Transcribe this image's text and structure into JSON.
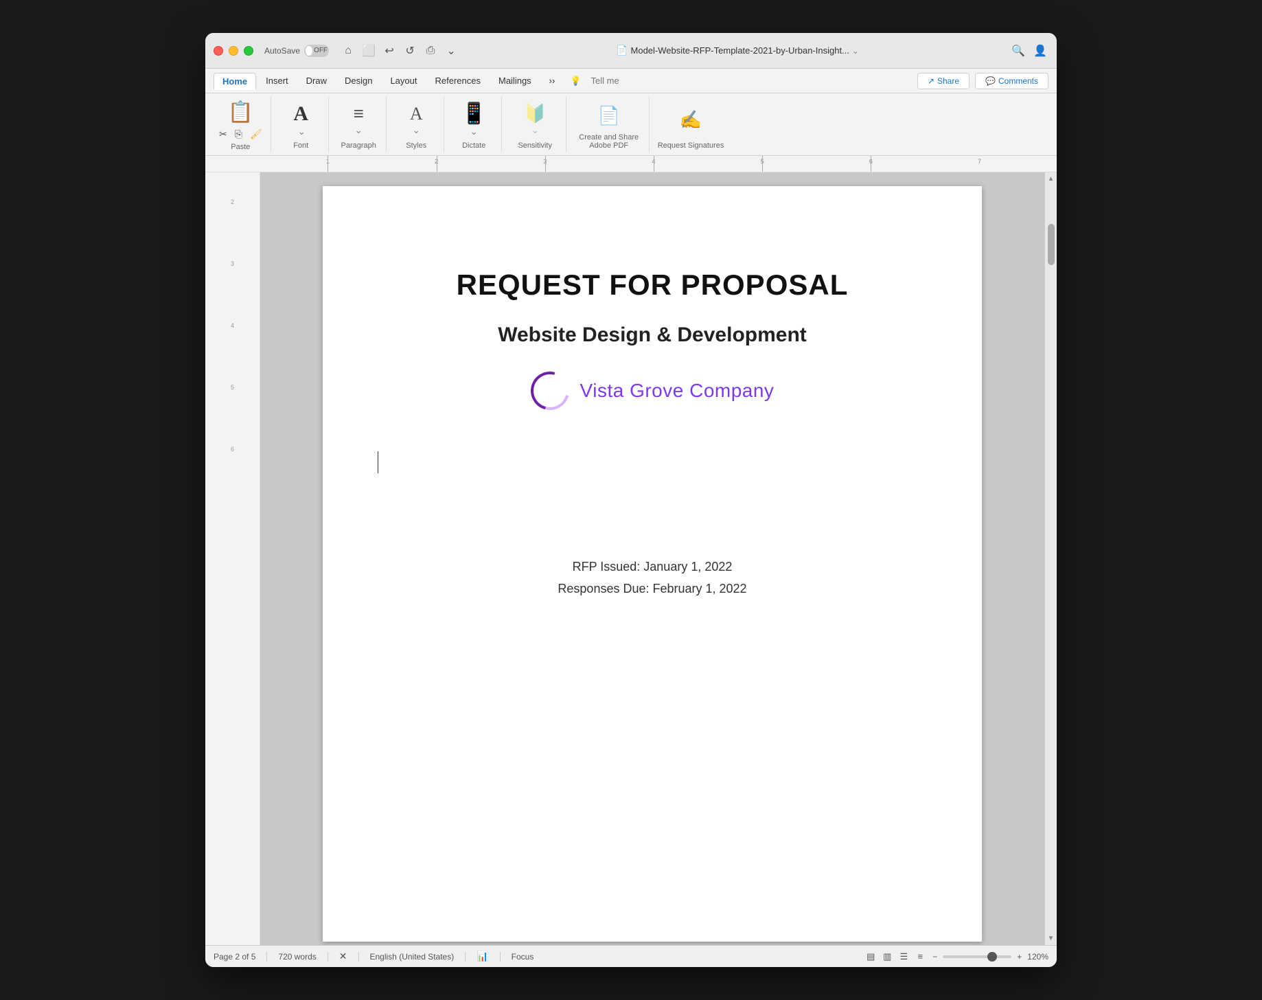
{
  "window": {
    "title": "Model-Website-RFP-Template-2021-by-Urban-Insight...",
    "autosave_label": "AutoSave",
    "autosave_state": "OFF"
  },
  "ribbon": {
    "tabs": [
      "Home",
      "Insert",
      "Draw",
      "Design",
      "Layout",
      "References",
      "Mailings"
    ],
    "active_tab": "Home",
    "more_label": "···",
    "tell_me_placeholder": "Tell me",
    "share_label": "Share",
    "comments_label": "Comments"
  },
  "toolbar": {
    "paste_label": "Paste",
    "font_label": "Font",
    "paragraph_label": "Paragraph",
    "styles_label": "Styles",
    "dictate_label": "Dictate",
    "sensitivity_label": "Sensitivity",
    "create_pdf_label": "Create and Share Adobe PDF",
    "request_sig_label": "Request Signatures"
  },
  "document": {
    "main_title": "REQUEST FOR PROPOSAL",
    "subtitle": "Website Design & Development",
    "company_name": "Vista Grove Company",
    "rfp_issued": "RFP Issued: January 1, 2022",
    "responses_due": "Responses Due: February 1, 2022"
  },
  "status_bar": {
    "page_info": "Page 2 of 5",
    "word_count": "720 words",
    "language": "English (United States)",
    "focus_label": "Focus",
    "zoom_level": "120%",
    "zoom_minus": "−",
    "zoom_plus": "+"
  },
  "ruler": {
    "marks": [
      "1",
      "2",
      "3",
      "4",
      "5",
      "6",
      "7"
    ]
  }
}
